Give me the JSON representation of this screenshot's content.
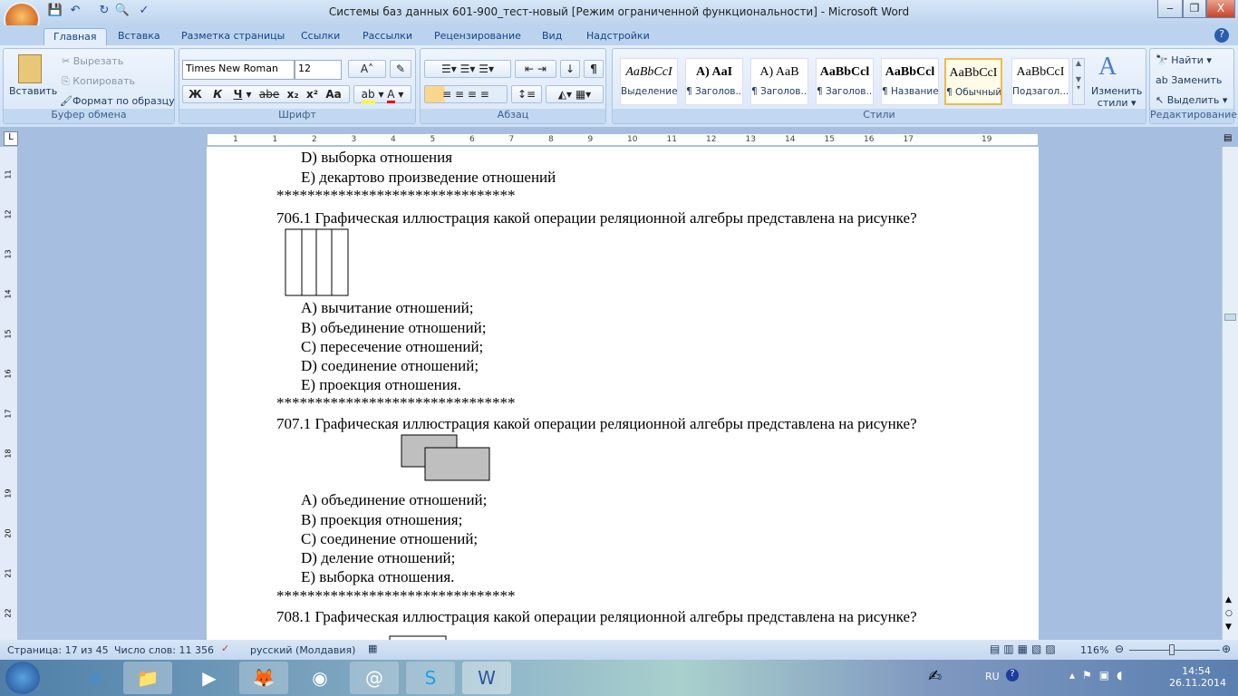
{
  "window": {
    "title": "Системы баз данных 601-900_тест-новый [Режим ограниченной функциональности] - Microsoft Word",
    "minimize": "‒",
    "restore": "❐",
    "close": "X"
  },
  "tabs": [
    "Главная",
    "Вставка",
    "Разметка страницы",
    "Ссылки",
    "Рассылки",
    "Рецензирование",
    "Вид",
    "Надстройки"
  ],
  "clipboard": {
    "paste": "Вставить",
    "cut": "Вырезать",
    "copy": "Копировать",
    "format_painter": "Формат по образцу",
    "label": "Буфер обмена"
  },
  "font": {
    "name": "Times New Roman",
    "size": "12",
    "label": "Шрифт",
    "bold": "Ж",
    "italic": "К",
    "underline": "Ч",
    "strike": "abe",
    "sub": "x₂",
    "sup": "x²",
    "case": "Aa",
    "grow": "A˄",
    "shrink": "A˅"
  },
  "paragraph": {
    "label": "Абзац",
    "pilcrow": "¶"
  },
  "styles": {
    "label": "Стили",
    "items": [
      {
        "sample": "AaBbCcI",
        "name": "Выделение"
      },
      {
        "sample": "A)  AaI",
        "name": "¶ Заголов..."
      },
      {
        "sample": "A)  AaB",
        "name": "¶ Заголов..."
      },
      {
        "sample": "AaBbCcl",
        "name": "¶ Заголов..."
      },
      {
        "sample": "AaBbCcl",
        "name": "¶ Название"
      },
      {
        "sample": "AaBbCcI",
        "name": "¶ Обычный"
      },
      {
        "sample": "AaBbCcI",
        "name": "Подзагол..."
      }
    ],
    "change_line1": "Изменить",
    "change_line2": "стили ▾"
  },
  "editing": {
    "label": "Редактирование",
    "find": "Найти ▾",
    "replace": "Заменить",
    "select": "Выделить ▾"
  },
  "ruler_ticks": [
    "1",
    "1",
    "2",
    "3",
    "4",
    "5",
    "6",
    "7",
    "8",
    "9",
    "10",
    "11",
    "12",
    "13",
    "14",
    "15",
    "16",
    "17",
    "19"
  ],
  "vruler_ticks": [
    "11",
    "12",
    "13",
    "14",
    "15",
    "16",
    "17",
    "18",
    "19",
    "20",
    "21",
    "22"
  ],
  "document": {
    "lines": [
      "D) выборка отношения",
      "E) декартово произведение отношений",
      "*******************************",
      "706.1 Графическая иллюстрация какой операции реляционной алгебры представлена на рисунке?",
      "A) вычитание отношений;",
      "B) объединение отношений;",
      "C) пересечение отношений;",
      "D) соединение отношений;",
      "E) проекция отношения.",
      "*******************************",
      "707.1 Графическая иллюстрация какой операции реляционной алгебры представлена на рисунке?",
      "A) объединение отношений;",
      "B) проекция отношения;",
      "C) соединение отношений;",
      "D) деление отношений;",
      "E) выборка отношения.",
      "*******************************",
      "708.1 Графическая иллюстрация какой операции реляционной алгебры представлена на рисунке?"
    ]
  },
  "status": {
    "page": "Страница: 17 из 45",
    "words": "Число слов: 11 356",
    "language": "русский (Молдавия)",
    "zoom": "116%"
  },
  "tray": {
    "lang": "RU",
    "time": "14:54",
    "date": "26.11.2014"
  }
}
